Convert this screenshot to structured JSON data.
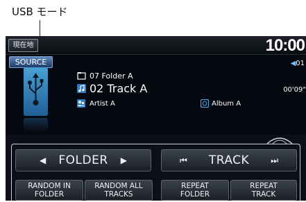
{
  "callout": {
    "text": "USB モード"
  },
  "topbar": {
    "home_label": "現在地",
    "clock": "10:00"
  },
  "source_button": {
    "label": "SOURCE"
  },
  "media": {
    "folder": "07 Folder A",
    "track": "02 Track A",
    "artist": "Artist A",
    "album": "Album A",
    "track_number": "01",
    "elapsed": "00'09\""
  },
  "controls": {
    "folder_label": "FOLDER",
    "track_label": "TRACK",
    "random_in_folder": [
      "RANDOM IN",
      "FOLDER"
    ],
    "random_all_tracks": [
      "RANDOM ALL",
      "TRACKS"
    ],
    "repeat_folder": [
      "REPEAT",
      "FOLDER"
    ],
    "repeat_track": [
      "REPEAT",
      "TRACK"
    ]
  },
  "icons": [
    "usb-icon",
    "folder-icon",
    "music-note-icon",
    "artist-icon",
    "album-icon",
    "speaker-icon",
    "left-arrow-icon",
    "right-arrow-icon",
    "skip-back-icon",
    "skip-forward-icon"
  ],
  "colors": {
    "accent": "#2f7fc0",
    "background": "#060810",
    "text": "#ffffff"
  }
}
